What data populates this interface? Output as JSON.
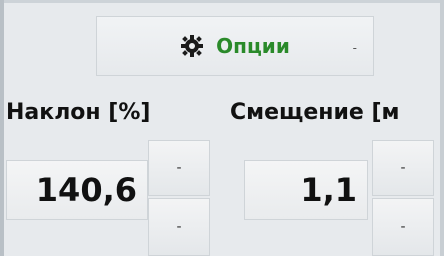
{
  "options": {
    "label": "Опции",
    "caret": "-",
    "icon": "gear-icon",
    "label_color": "#2a8a2a"
  },
  "slope": {
    "label": "Наклон [%]",
    "value": "140,6",
    "up": "-",
    "down": "-"
  },
  "shift": {
    "label": "Смещение [м",
    "value": "1,1",
    "up": "-",
    "down": "-"
  }
}
